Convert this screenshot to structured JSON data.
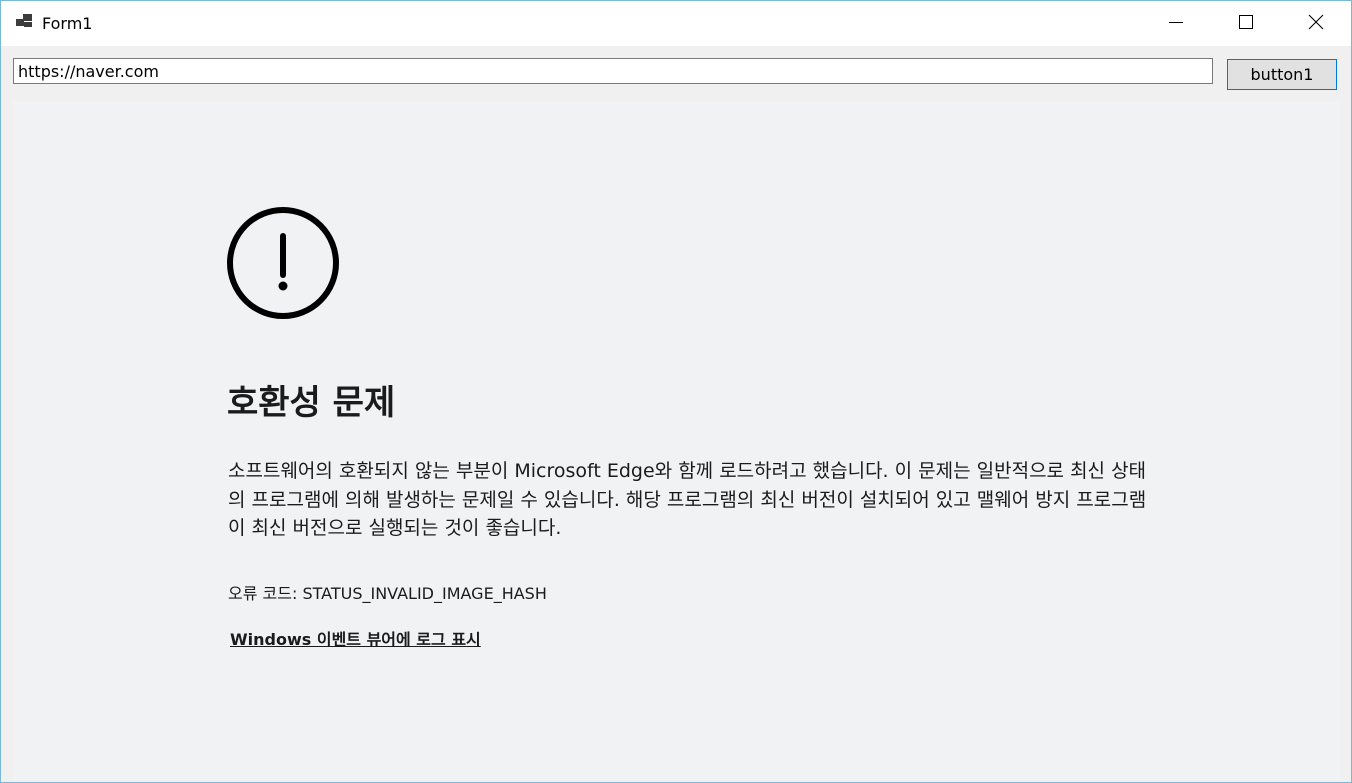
{
  "window": {
    "title": "Form1",
    "icons": {
      "app": "app-form-icon",
      "minimize": "minimize-icon",
      "maximize": "maximize-icon",
      "close": "close-icon"
    }
  },
  "toolbar": {
    "url_value": "https://naver.com",
    "button_label": "button1"
  },
  "error_page": {
    "icon": "exclamation-circle-icon",
    "title": "호환성 문제",
    "description": "소프트웨어의 호환되지 않는 부분이 Microsoft Edge와 함께 로드하려고 했습니다. 이 문제는 일반적으로 최신 상태의 프로그램에 의해 발생하는 문제일 수 있습니다. 해당 프로그램의 최신 버전이 설치되어 있고 맬웨어 방지 프로그램이 최신 버전으로 실행되는 것이 좋습니다.",
    "error_code_label": "오류 코드: ",
    "error_code_value": "STATUS_INVALID_IMAGE_HASH",
    "event_viewer_link": "Windows 이벤트 뷰어에 로그 표시"
  },
  "colors": {
    "window_border": "#7ab8d8",
    "button_border": "#0078d7",
    "page_background": "#f1f2f4",
    "text": "#1b1b1b"
  }
}
